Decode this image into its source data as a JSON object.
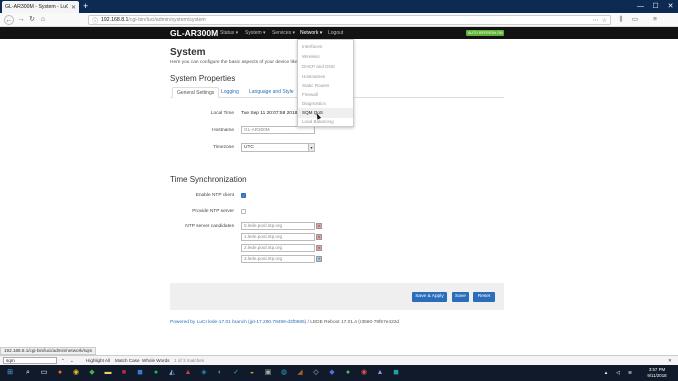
{
  "browser": {
    "tab_title": "GL-AR300M - System - LuCI",
    "new_tab": "+",
    "url_host": "192.168.8.1",
    "url_path": "/cgi-bin/luci/admin/system/system",
    "win_min": "—",
    "win_max": "☐",
    "win_close": "✕"
  },
  "luci": {
    "brand": "GL-AR300M",
    "menu": [
      "Status ▾",
      "System ▾",
      "Services ▾",
      "Network ▾",
      "Logout"
    ],
    "autorefresh": "AUTO REFRESH ON"
  },
  "network_menu": {
    "items": [
      "Interfaces",
      "Wireless",
      "DHCP and DNS",
      "Hostnames",
      "Static Routes",
      "Firewall",
      "Diagnostics",
      "SQM QoS",
      "Load Balancing"
    ],
    "highlighted": "SQM QoS"
  },
  "page": {
    "title": "System",
    "description": "Here you can configure the basic aspects of your device like its",
    "section_title": "System Properties",
    "tabs": [
      "General Settings",
      "Logging",
      "Language and Style"
    ],
    "fields": {
      "local_time_label": "Local Time",
      "local_time_value": "Tue Sep 11 20:07:58 2018",
      "hostname_label": "Hostname",
      "hostname_value": "GL-AR300M",
      "timezone_label": "Timezone",
      "timezone_value": "UTC"
    },
    "time_sync_title": "Time Synchronization",
    "ntp": {
      "enable_label": "Enable NTP client",
      "provide_label": "Provide NTP server",
      "candidates_label": "NTP server candidates",
      "servers": [
        "0.lede.pool.ntp.org",
        "1.lede.pool.ntp.org",
        "2.lede.pool.ntp.org",
        "3.lede.pool.ntp.org"
      ]
    },
    "buttons": {
      "save_apply": "Save & Apply",
      "save": "Save",
      "reset": "Reset"
    },
    "footer_link": "Powered by LuCI lede-17.01 branch (git-17.290.79498-d3f0685)",
    "footer_rest": " / LEDE Reboot 17.01.4 (r3560-79f57e422d"
  },
  "statusbar": {
    "link_url": "192.168.8.1/cgi-bin/luci/admin/network/sqm"
  },
  "findbar": {
    "query": "sqm",
    "highlight_all": "Highlight All",
    "match_case": "Match Case",
    "whole_words": "Whole Words",
    "matches": "1 of 3 matches"
  },
  "taskbar": {
    "time": "3:57 PM",
    "date": "9/11/2018"
  },
  "colors": {
    "accent": "#2a6ebb",
    "header_bg": "#131313",
    "autorefresh": "#5fb335"
  }
}
